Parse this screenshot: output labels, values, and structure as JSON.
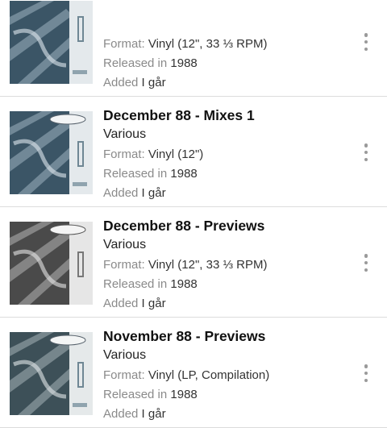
{
  "releases": [
    {
      "title": "",
      "artist": "",
      "format_label": "Format:",
      "format": "Vinyl (12\", 33 ⅓ RPM)",
      "released_label": "Released in",
      "year": "1988",
      "added_label": "Added",
      "added": "I går",
      "cover_tint": "#3b5566"
    },
    {
      "title": "December 88 - Mixes 1",
      "artist": "Various",
      "format_label": "Format:",
      "format": "Vinyl (12\")",
      "released_label": "Released in",
      "year": "1988",
      "added_label": "Added",
      "added": "I går",
      "cover_tint": "#3b5566"
    },
    {
      "title": "December 88 - Previews",
      "artist": "Various",
      "format_label": "Format:",
      "format": "Vinyl (12\", 33 ⅓ RPM)",
      "released_label": "Released in",
      "year": "1988",
      "added_label": "Added",
      "added": "I går",
      "cover_tint": "#4a4a4a"
    },
    {
      "title": "November 88 - Previews",
      "artist": "Various",
      "format_label": "Format:",
      "format": "Vinyl (LP, Compilation)",
      "released_label": "Released in",
      "year": "1988",
      "added_label": "Added",
      "added": "I går",
      "cover_tint": "#3d5058"
    }
  ]
}
